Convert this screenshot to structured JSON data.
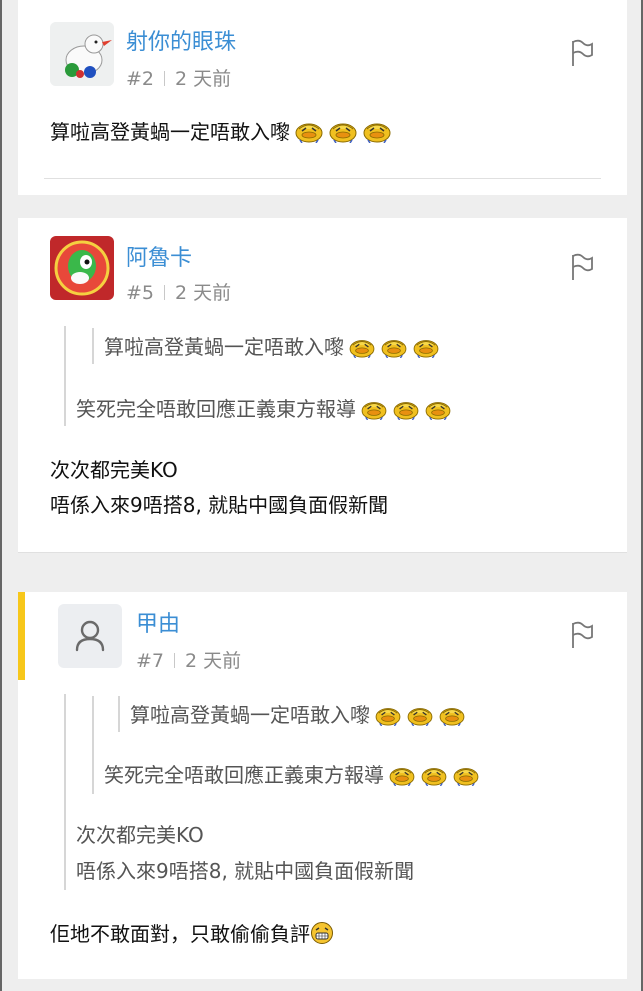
{
  "posts": [
    {
      "username": "射你的眼珠",
      "post_number": "#2",
      "time": "2 天前",
      "avatar_icon": "bird-avatar-icon",
      "body": "算啦高登黃蝸一定唔敢入嚟"
    },
    {
      "username": "阿魯卡",
      "post_number": "#5",
      "time": "2 天前",
      "avatar_icon": "yoshi-avatar-icon",
      "quote_inner": "算啦高登黃蝸一定唔敢入嚟",
      "quote_outer": "笑死完全唔敢回應正義東方報導",
      "body_line1": "次次都完美KO",
      "body_line2": "唔係入來9唔搭8, 就貼中國負面假新聞"
    },
    {
      "username": "甲由",
      "post_number": "#7",
      "time": "2 天前",
      "avatar_icon": "default-user-icon",
      "quote_inner": "算啦高登黃蝸一定唔敢入嚟",
      "quote_middle": "笑死完全唔敢回應正義東方報導",
      "quote_outer_line1": "次次都完美KO",
      "quote_outer_line2": "唔係入來9唔搭8, 就貼中國負面假新聞",
      "body": "佢地不敢面對，只敢偷偷負評"
    }
  ],
  "colors": {
    "username": "#3b8ed4",
    "highlight": "#f7c71a",
    "meta": "#8a8a8a"
  }
}
